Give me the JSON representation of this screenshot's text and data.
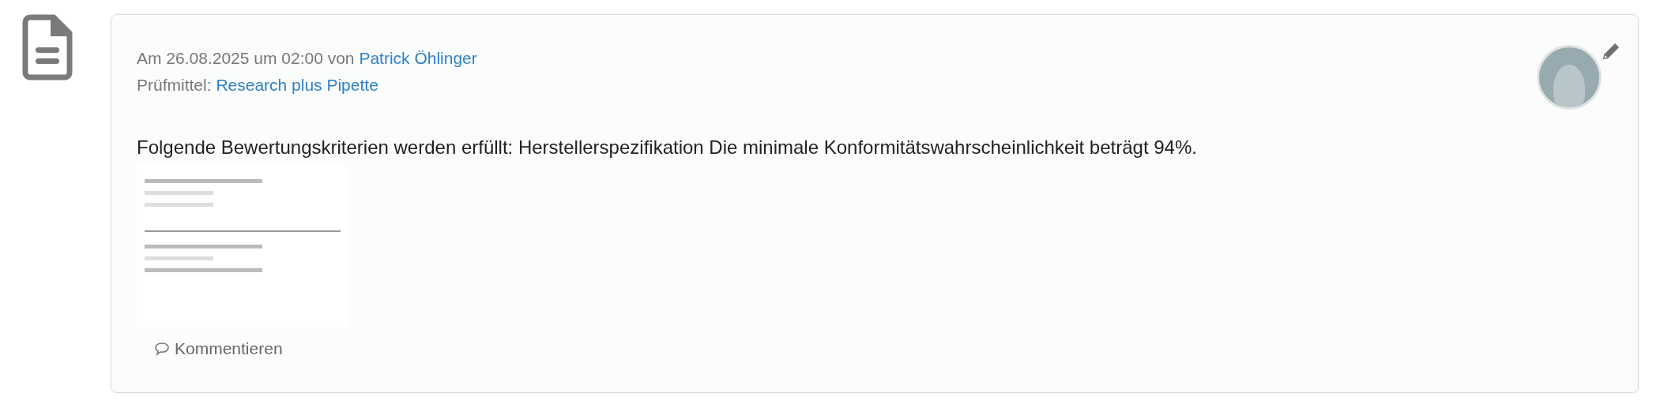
{
  "entry": {
    "date_line": "Am 26.08.2025 um 02:00 von",
    "author": "Patrick Öhlinger",
    "equipment_label": "Prüfmittel:",
    "equipment": "Research plus Pipette",
    "message": "Folgende Bewertungskriterien werden erfüllt: Herstellerspezifikation Die minimale Konformitätswahrscheinlichkeit beträgt 94%.",
    "comment_button": "Kommentieren"
  }
}
